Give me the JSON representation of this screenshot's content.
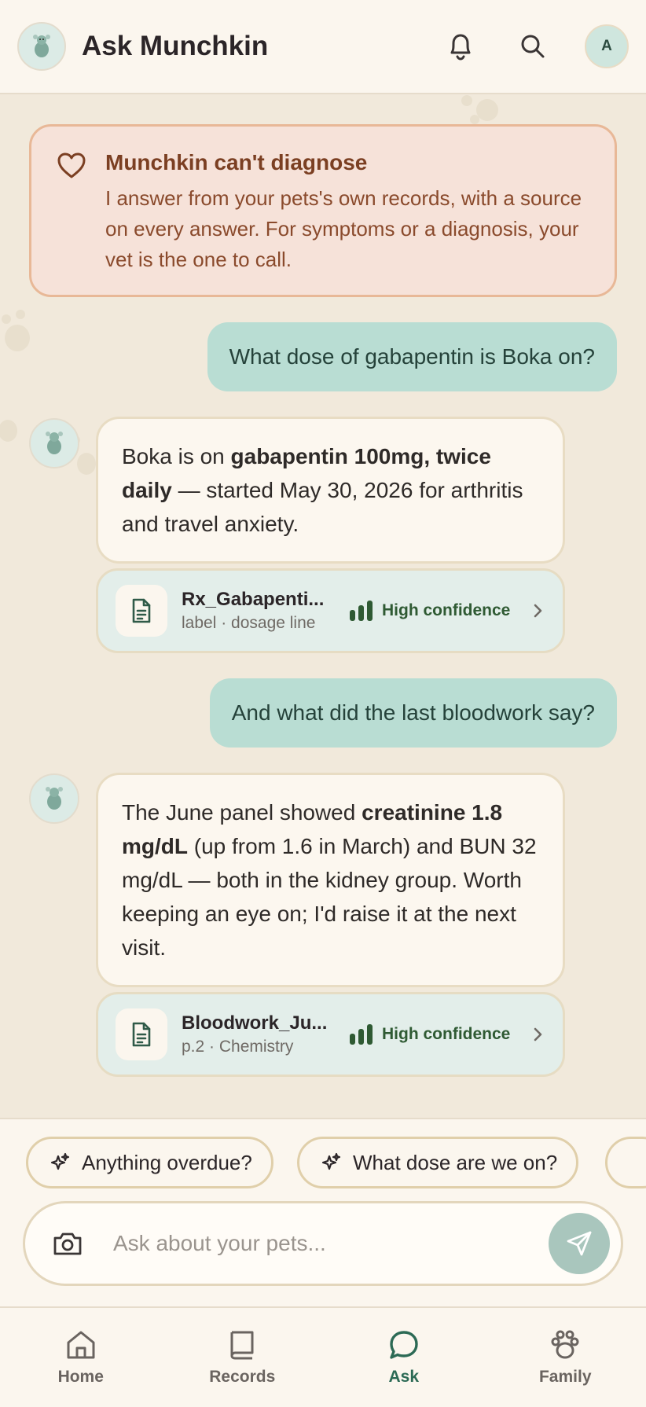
{
  "header": {
    "title": "Ask Munchkin",
    "avatar_initial": "A"
  },
  "notice": {
    "title": "Munchkin can't diagnose",
    "body": "I answer from your pets's own records, with a source on every answer. For symptoms or a diagnosis, your vet is the one to call."
  },
  "messages": [
    {
      "role": "user",
      "text": "What dose of gabapentin is Boka on?"
    },
    {
      "role": "assistant",
      "text_parts": [
        "Boka is on ",
        "gabapentin 100mg, twice daily",
        " — started May 30, 2026 for arthritis and travel anxiety."
      ],
      "source": {
        "name": "Rx_Gabapenti...",
        "detail": "label · dosage line",
        "confidence": "High confidence"
      }
    },
    {
      "role": "user",
      "text": "And what did the last bloodwork say?"
    },
    {
      "role": "assistant",
      "text_parts": [
        "The June panel showed ",
        "creatinine 1.8 mg/dL",
        " (up from 1.6 in March) and BUN 32 mg/dL — both in the kidney group. Worth keeping an eye on; I'd raise it at the next visit."
      ],
      "source": {
        "name": "Bloodwork_Ju...",
        "detail": "p.2 · Chemistry",
        "confidence": "High confidence"
      }
    }
  ],
  "suggestions": [
    "Anything overdue?",
    "What dose are we on?"
  ],
  "composer": {
    "placeholder": "Ask about your pets..."
  },
  "nav": {
    "items": [
      {
        "label": "Home",
        "icon": "home-icon"
      },
      {
        "label": "Records",
        "icon": "book-icon"
      },
      {
        "label": "Ask",
        "icon": "chat-icon",
        "active": true
      },
      {
        "label": "Family",
        "icon": "paw-icon"
      }
    ]
  },
  "colors": {
    "background": "#f1e9db",
    "accent": "#2c6a55",
    "user_bubble": "#b9ddd3",
    "notice_bg": "#f6e2d9",
    "notice_border": "#e8b897",
    "confidence": "#2f5a33"
  }
}
